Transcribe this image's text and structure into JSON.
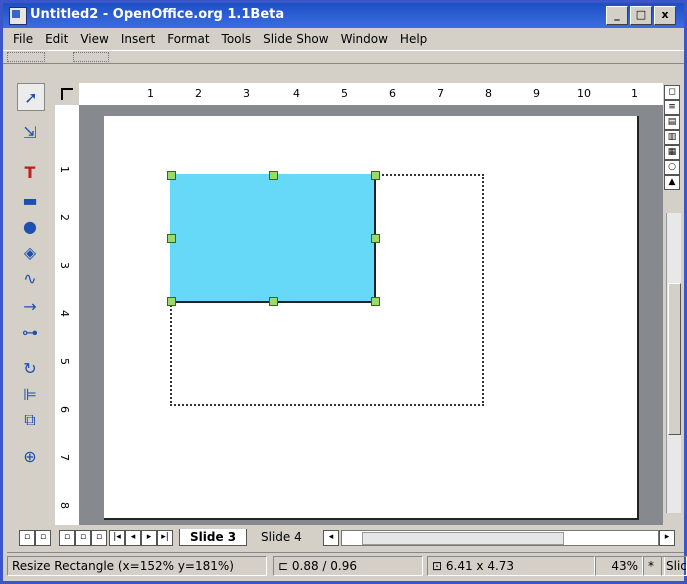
{
  "window": {
    "title": "Untitled2 - OpenOffice.org 1.1Beta",
    "minimize": "_",
    "restore": "□",
    "close": "x"
  },
  "menu": [
    {
      "label": "File"
    },
    {
      "label": "Edit"
    },
    {
      "label": "View"
    },
    {
      "label": "Insert"
    },
    {
      "label": "Format"
    },
    {
      "label": "Tools"
    },
    {
      "label": "Slide Show"
    },
    {
      "label": "Window"
    },
    {
      "label": "Help"
    }
  ],
  "ruler": {
    "h_numbers": [
      "1",
      "2",
      "3",
      "4",
      "5",
      "6",
      "7",
      "8",
      "9",
      "10",
      "1"
    ],
    "v_numbers": [
      "1",
      "2",
      "3",
      "4",
      "5",
      "6",
      "7",
      "8"
    ]
  },
  "tabs": {
    "active": "Slide 3",
    "other": "Slide 4"
  },
  "status": {
    "action": "Resize Rectangle (x=152% y=181%)",
    "position": "0.88 / 0.96",
    "size": "6.41 x 4.73",
    "zoom": "43%",
    "mode": "*",
    "slide": "Slic"
  },
  "colors": {
    "titlebar": "#1c4fc4",
    "shape_fill": "#66d8f8",
    "handle": "#9bd96b",
    "canvas_bg": "#868a8e"
  },
  "icons": [
    "select-arrow-icon",
    "zoom-icon",
    "text-icon",
    "rectangle-icon",
    "ellipse-icon",
    "3d-object-icon",
    "curve-icon",
    "line-icon",
    "connector-icon",
    "rotate-icon",
    "align-icon",
    "arrange-icon",
    "insert-icon"
  ]
}
